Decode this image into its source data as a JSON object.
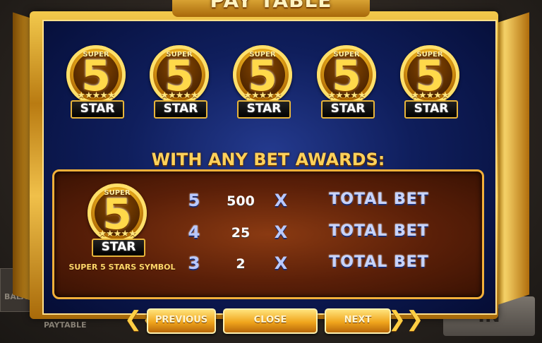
{
  "title": "PAY TABLE",
  "background": {
    "balance_label": "BALAN",
    "paytable_label": "PAYTABLE",
    "spin_label": "IN"
  },
  "badge": {
    "super": "SUPER",
    "number": "5",
    "stars": "★★★★★",
    "star": "STAR"
  },
  "awards_title": "WITH ANY BET AWARDS:",
  "symbol_caption": "SUPER 5 STARS SYMBOL",
  "paytable": [
    {
      "count": "5",
      "multiplier": "500",
      "x": "X",
      "label": "TOTAL BET"
    },
    {
      "count": "4",
      "multiplier": "25",
      "x": "X",
      "label": "TOTAL BET"
    },
    {
      "count": "3",
      "multiplier": "2",
      "x": "X",
      "label": "TOTAL BET"
    }
  ],
  "buttons": {
    "previous": "PREVIOUS",
    "close": "CLOSE",
    "next": "NEXT",
    "prev_chevron": "❮❮",
    "next_chevron": "❯❯"
  },
  "colors": {
    "gold": "#f2b03a",
    "navy": "#0f1e5c",
    "panel_brown": "#5a1f08"
  }
}
